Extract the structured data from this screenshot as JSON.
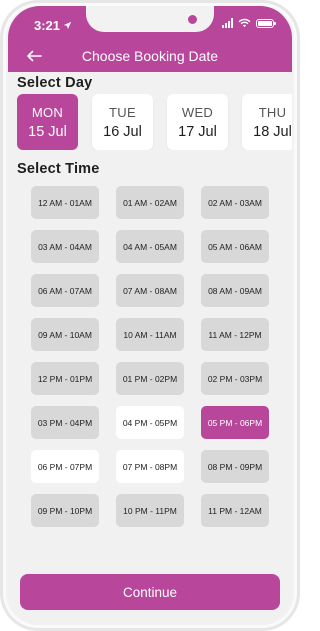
{
  "status_bar": {
    "time": "3:21",
    "location_icon": "navigation-arrow-icon",
    "icons": [
      "cellular-signal-icon",
      "wifi-icon",
      "battery-icon"
    ]
  },
  "header": {
    "back_icon": "arrow-left-icon",
    "title": "Choose Booking Date"
  },
  "select_day": {
    "heading": "Select Day",
    "days": [
      {
        "dow": "MON",
        "date": "15 Jul",
        "selected": true
      },
      {
        "dow": "TUE",
        "date": "16 Jul",
        "selected": false
      },
      {
        "dow": "WED",
        "date": "17 Jul",
        "selected": false
      },
      {
        "dow": "THU",
        "date": "18 Jul",
        "selected": false
      }
    ]
  },
  "select_time": {
    "heading": "Select Time",
    "slots": [
      {
        "label": "12 AM - 01AM",
        "state": "unavailable"
      },
      {
        "label": "01 AM - 02AM",
        "state": "unavailable"
      },
      {
        "label": "02 AM - 03AM",
        "state": "unavailable"
      },
      {
        "label": "03 AM - 04AM",
        "state": "unavailable"
      },
      {
        "label": "04 AM - 05AM",
        "state": "unavailable"
      },
      {
        "label": "05 AM - 06AM",
        "state": "unavailable"
      },
      {
        "label": "06 AM - 07AM",
        "state": "unavailable"
      },
      {
        "label": "07 AM - 08AM",
        "state": "unavailable"
      },
      {
        "label": "08 AM - 09AM",
        "state": "unavailable"
      },
      {
        "label": "09 AM - 10AM",
        "state": "unavailable"
      },
      {
        "label": "10 AM - 11AM",
        "state": "unavailable"
      },
      {
        "label": "11 AM - 12PM",
        "state": "unavailable"
      },
      {
        "label": "12 PM - 01PM",
        "state": "unavailable"
      },
      {
        "label": "01 PM - 02PM",
        "state": "unavailable"
      },
      {
        "label": "02 PM - 03PM",
        "state": "unavailable"
      },
      {
        "label": "03 PM - 04PM",
        "state": "unavailable"
      },
      {
        "label": "04 PM - 05PM",
        "state": "available"
      },
      {
        "label": "05 PM - 06PM",
        "state": "selected"
      },
      {
        "label": "06 PM - 07PM",
        "state": "available"
      },
      {
        "label": "07 PM - 08PM",
        "state": "available"
      },
      {
        "label": "08 PM - 09PM",
        "state": "unavailable"
      },
      {
        "label": "09 PM - 10PM",
        "state": "unavailable"
      },
      {
        "label": "10 PM - 11PM",
        "state": "unavailable"
      },
      {
        "label": "11 PM - 12AM",
        "state": "unavailable"
      }
    ]
  },
  "footer": {
    "continue_label": "Continue"
  },
  "colors": {
    "accent": "#b8469a",
    "background": "#f1f1f1",
    "slot_unavailable": "#d8d8d8",
    "slot_available": "#ffffff"
  }
}
